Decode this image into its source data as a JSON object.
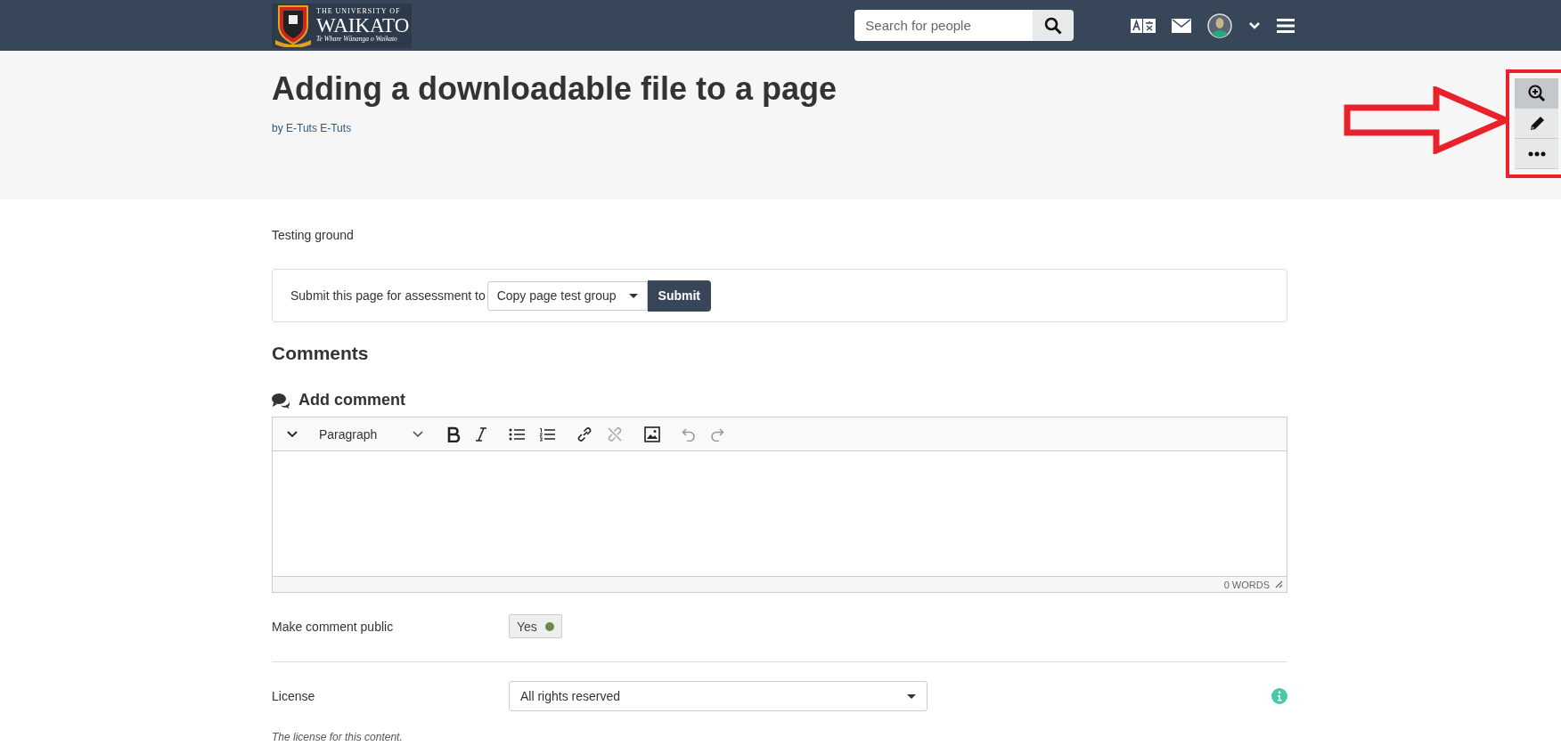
{
  "header": {
    "logo": {
      "line_1": "THE UNIVERSITY OF",
      "line_2": "WAIKATO",
      "line_3": "Te Whare Wānanga o Waikato"
    },
    "search": {
      "placeholder": "Search for people"
    },
    "icons": [
      {
        "kind": "translate"
      },
      {
        "kind": "mail"
      },
      {
        "kind": "avatar"
      },
      {
        "kind": "chevron"
      },
      {
        "kind": "menu"
      }
    ]
  },
  "page": {
    "title": "Adding a downloadable file to a page",
    "author": "by E-Tuts E-Tuts",
    "tools": [
      {
        "kind": "zoom",
        "selected": true
      },
      {
        "kind": "edit",
        "selected": false
      },
      {
        "kind": "more",
        "selected": false
      }
    ],
    "description": "Testing ground"
  },
  "submit": {
    "label": "Submit this page for assessment to",
    "group": "Copy page test group",
    "button": "Submit"
  },
  "comments": {
    "heading": "Comments",
    "add_heading": "Add comment",
    "editor": {
      "format": "Paragraph",
      "toolbar": [
        {
          "kind": "bold"
        },
        {
          "kind": "italic"
        },
        {
          "kind": "bullets"
        },
        {
          "kind": "numbers"
        },
        {
          "kind": "link"
        },
        {
          "kind": "unlink"
        },
        {
          "kind": "image"
        },
        {
          "kind": "undo"
        },
        {
          "kind": "redo"
        }
      ],
      "word_count": "0 WORDS"
    },
    "public": {
      "label": "Make comment public",
      "value": "Yes",
      "on": true
    },
    "license": {
      "label": "License",
      "value": "All rights reserved",
      "help": "The license for this content."
    }
  }
}
